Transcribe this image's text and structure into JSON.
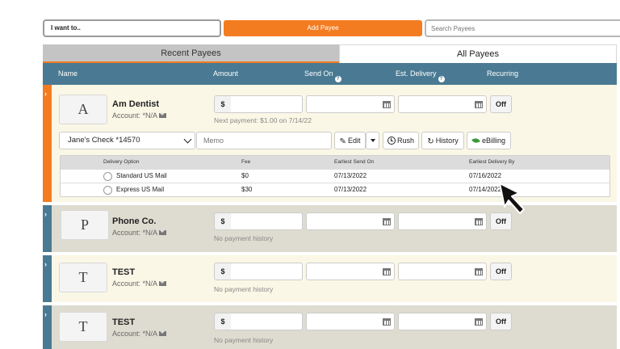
{
  "topbar": {
    "want_to": "I want to..",
    "add_payee": "Add Payee",
    "search_placeholder": "Search Payees"
  },
  "tabs": {
    "recent": "Recent Payees",
    "all": "All Payees"
  },
  "columns": {
    "name": "Name",
    "amount": "Amount",
    "send_on": "Send On",
    "est_delivery": "Est. Delivery",
    "recurring": "Recurring"
  },
  "payees": [
    {
      "initial": "A",
      "name": "Am Dentist",
      "account": "Account: *N/A",
      "amount_prefix": "$",
      "recurring": "Off",
      "note": "Next payment: $1.00 on 7/14/22"
    },
    {
      "initial": "P",
      "name": "Phone Co.",
      "account": "Account: *N/A",
      "amount_prefix": "$",
      "recurring": "Off",
      "note": "No payment history"
    },
    {
      "initial": "T",
      "name": "TEST",
      "account": "Account: *N/A",
      "amount_prefix": "$",
      "recurring": "Off",
      "note": "No payment history"
    },
    {
      "initial": "T",
      "name": "TEST",
      "account": "Account: *N/A",
      "amount_prefix": "$",
      "recurring": "Off",
      "note": "No payment history"
    }
  ],
  "detail": {
    "check_account": "Jane's Check *14570",
    "memo_placeholder": "Memo",
    "edit": "Edit",
    "rush": "Rush",
    "history": "History",
    "ebilling": "eBilling",
    "options_header": {
      "delivery_option": "Delivery Option",
      "fee": "Fee",
      "earliest_send_on": "Earliest Send On",
      "earliest_delivery_by": "Earliest Delivery By"
    },
    "options": [
      {
        "option": "Standard US Mail",
        "fee": "$0",
        "send_on": "07/13/2022",
        "delivery_by": "07/16/2022"
      },
      {
        "option": "Express US Mail",
        "fee": "$30",
        "send_on": "07/13/2022",
        "delivery_by": "07/14/2022"
      }
    ]
  },
  "colors": {
    "accent_orange": "#f47c20",
    "header_blue": "#4a7a93",
    "row_cream": "#fbf7e6",
    "row_gray": "#dedcd0"
  }
}
